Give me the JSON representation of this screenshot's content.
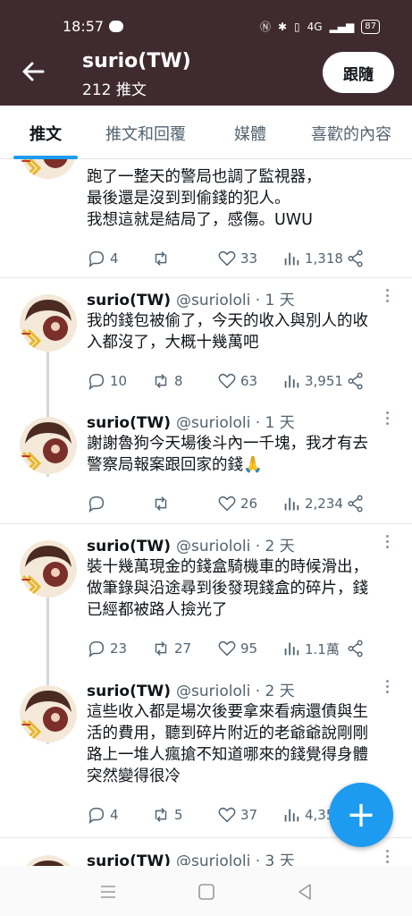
{
  "status_bar": {
    "time": "18:57",
    "signal": "4G",
    "battery": "87"
  },
  "header": {
    "name": "surio(TW)",
    "post_count": "212 推文",
    "follow_label": "跟隨"
  },
  "tabs": [
    {
      "label": "推文",
      "active": true
    },
    {
      "label": "推文和回覆",
      "active": false
    },
    {
      "label": "媒體",
      "active": false
    },
    {
      "label": "喜歡的內容",
      "active": false
    }
  ],
  "tweets": [
    {
      "name": "",
      "handle": "",
      "time": "",
      "lines": [
        "跑了一整天的警局也調了監視器，",
        "最後還是沒到到偷錢的犯人。",
        "我想這就是結局了，感傷。UWU"
      ],
      "replies": "4",
      "retweets": "",
      "likes": "33",
      "views": "1,318"
    },
    {
      "name": "surio(TW)",
      "handle": "@suriololi · 1 天",
      "time": "",
      "lines": [
        "我的錢包被偷了，今天的收入與別人的收",
        "入都沒了，大概十幾萬吧"
      ],
      "replies": "10",
      "retweets": "8",
      "likes": "63",
      "views": "3,951"
    },
    {
      "name": "surio(TW)",
      "handle": "@suriololi · 1 天",
      "time": "",
      "lines": [
        "謝謝魯狗今天場後斗內一千塊，我才有去",
        "警察局報案跟回家的錢🙏"
      ],
      "replies": "",
      "retweets": "",
      "likes": "26",
      "views": "2,234"
    },
    {
      "name": "surio(TW)",
      "handle": "@suriololi · 2 天",
      "time": "",
      "lines": [
        "裝十幾萬現金的錢盒騎機車的時候滑出，",
        "做筆錄與沿途尋到後發現錢盒的碎片，錢",
        "已經都被路人撿光了"
      ],
      "replies": "23",
      "retweets": "27",
      "likes": "95",
      "views": "1.1萬"
    },
    {
      "name": "surio(TW)",
      "handle": "@suriololi · 2 天",
      "time": "",
      "lines": [
        "這些收入都是場次後要拿來看病還債與生",
        "活的費用，聽到碎片附近的老爺爺說剛剛",
        "路上一堆人瘋搶不知道哪來的錢覺得身體",
        "突然變得很冷"
      ],
      "replies": "4",
      "retweets": "5",
      "likes": "37",
      "views": "4,35"
    },
    {
      "name": "surio(TW)",
      "handle": "@suriololi · 3 天",
      "time": "",
      "lines": [],
      "replies": "",
      "retweets": "",
      "likes": "",
      "views": ""
    }
  ],
  "fab_label": "+",
  "colors": {
    "header_bg": "#3f2b2f",
    "accent": "#1d9bf0"
  }
}
